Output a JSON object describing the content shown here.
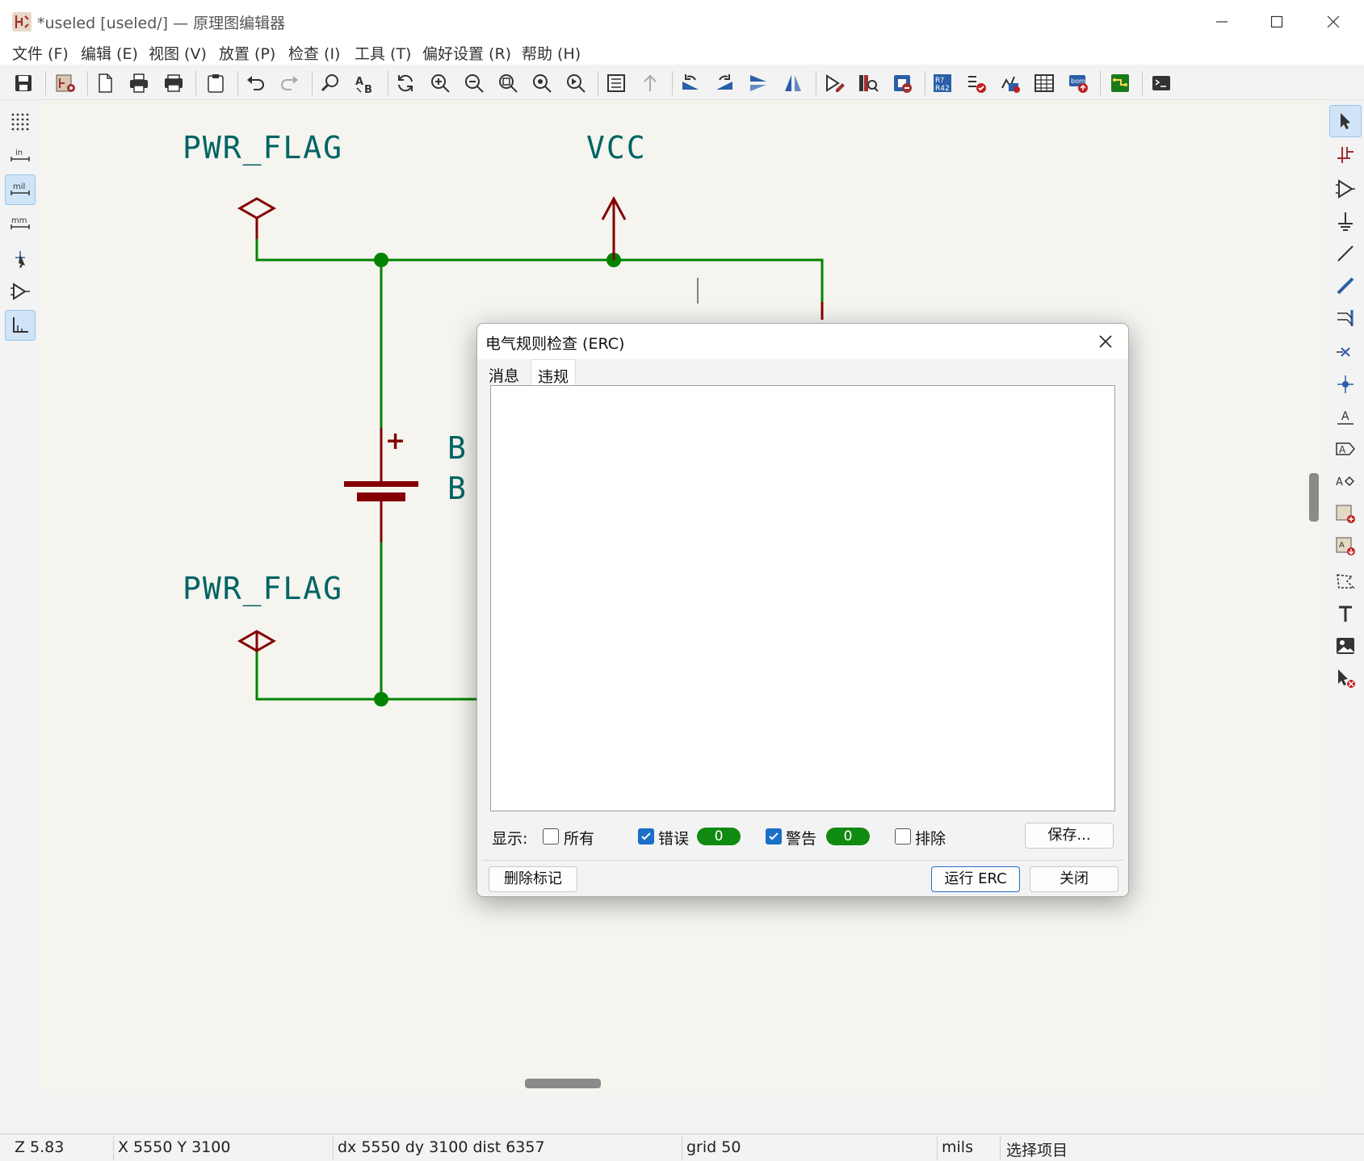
{
  "window": {
    "title": "*useled [useled/] — 原理图编辑器"
  },
  "menubar": {
    "items": [
      {
        "label": "文件 (F)"
      },
      {
        "label": "编辑 (E)"
      },
      {
        "label": "视图 (V)"
      },
      {
        "label": "放置 (P)"
      },
      {
        "label": "检查 (I)"
      },
      {
        "label": "工具 (T)"
      },
      {
        "label": "偏好设置 (R)"
      },
      {
        "label": "帮助 (H)"
      }
    ]
  },
  "toolbar": {
    "icons": [
      "save-icon",
      "schematic-setup-icon",
      "page-settings-icon",
      "print-icon",
      "plot-icon",
      "paste-icon",
      "undo-icon",
      "redo-icon",
      "find-icon",
      "find-replace-icon",
      "refresh-icon",
      "zoom-in-icon",
      "zoom-out-icon",
      "zoom-fit-icon",
      "zoom-objects-icon",
      "zoom-selection-icon",
      "hierarchy-navigator-icon",
      "leave-sheet-icon",
      "rotate-ccw-icon",
      "rotate-cw-icon",
      "mirror-vertical-icon",
      "mirror-horizontal-icon",
      "symbol-editor-icon",
      "symbol-browser-icon",
      "footprint-assign-icon",
      "annotate-icon",
      "erc-icon",
      "simulator-icon",
      "symbol-fields-table-icon",
      "generate-bom-icon",
      "pcb-editor-icon",
      "scripting-console-icon"
    ]
  },
  "left_toolbar": {
    "unit_in": "in",
    "unit_mil": "mil",
    "unit_mm": "mm"
  },
  "schematic": {
    "labels": {
      "pwr_flag_top": "PWR_FLAG",
      "vcc": "VCC",
      "pwr_flag_bottom": "PWR_FLAG",
      "battery_ref_partial": "B",
      "battery_value_partial": "B",
      "plus_sign": "+"
    },
    "colors": {
      "wire": "#008400",
      "junction": "#008400",
      "symbol": "#840000",
      "text": "#006464",
      "background": "#f5f4ef"
    }
  },
  "dialog": {
    "title": "电气规则检查 (ERC)",
    "tabs": [
      {
        "label": "消息"
      },
      {
        "label": "违规"
      }
    ],
    "active_tab": "违规",
    "show_label": "显示:",
    "filters": {
      "all": {
        "label": "所有",
        "checked": false
      },
      "errors": {
        "label": "错误",
        "checked": true,
        "count": "0"
      },
      "warnings": {
        "label": "警告",
        "checked": true,
        "count": "0"
      },
      "excluded": {
        "label": "排除",
        "checked": false
      }
    },
    "buttons": {
      "save": "保存...",
      "delete_markers": "删除标记",
      "run_erc": "运行 ERC",
      "close": "关闭"
    }
  },
  "statusbar": {
    "zoom": "Z 5.83",
    "xy": "X 5550  Y 3100",
    "delta": "dx 5550  dy 3100  dist 6357",
    "grid": "grid 50",
    "units": "mils",
    "mode": "选择项目"
  }
}
